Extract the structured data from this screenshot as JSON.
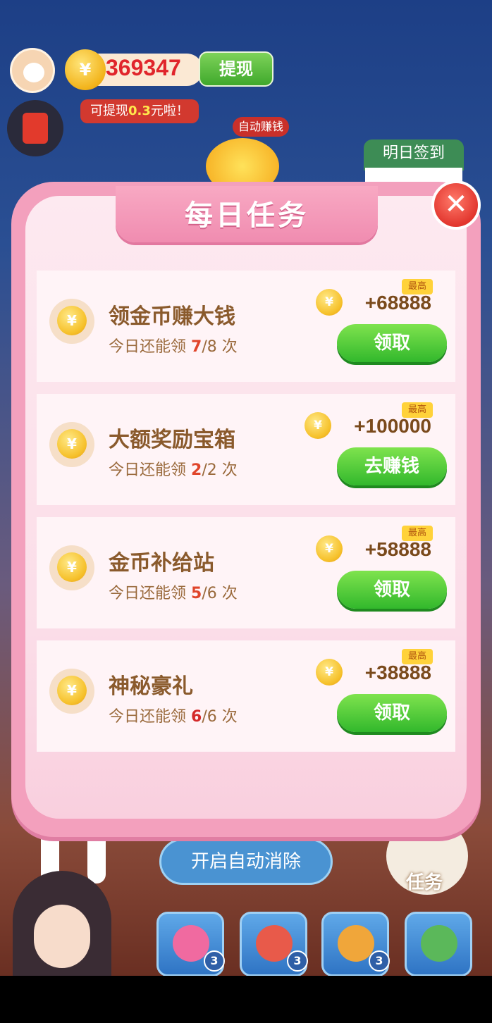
{
  "hud": {
    "coin_symbol": "¥",
    "coin_balance": "369347",
    "withdraw_label": "提现",
    "withdraw_tip_prefix": "可提现",
    "withdraw_tip_amount": "0.3",
    "withdraw_tip_suffix": "元啦！",
    "auto_earn_label": "自动赚钱",
    "sign_in_label": "明日签到"
  },
  "dialog": {
    "title": "每日任务",
    "close_glyph": "✕",
    "tasks": [
      {
        "name": "领金币赚大钱",
        "sub_prefix": "今日还能领 ",
        "count": "7",
        "total": "/8",
        "sub_suffix": " 次",
        "badge": "最高",
        "reward": "+68888",
        "action": "领取"
      },
      {
        "name": "大额奖励宝箱",
        "sub_prefix": "今日还能领 ",
        "count": "2",
        "total": "/2",
        "sub_suffix": " 次",
        "badge": "最高",
        "reward": "+100000",
        "action": "去赚钱"
      },
      {
        "name": "金币补给站",
        "sub_prefix": "今日还能领 ",
        "count": "5",
        "total": "/6",
        "sub_suffix": " 次",
        "badge": "最高",
        "reward": "+58888",
        "action": "领取"
      },
      {
        "name": "神秘豪礼",
        "sub_prefix": "今日还能领 ",
        "count": "6",
        "total": "/6",
        "sub_suffix": " 次",
        "badge": "最高",
        "reward": "+38888",
        "action": "领取"
      }
    ]
  },
  "bottom": {
    "auto_clear_label": "开启自动消除",
    "task_label": "任务",
    "props": [
      {
        "count": "3",
        "color": "#f06aa0"
      },
      {
        "count": "3",
        "color": "#e85a4a"
      },
      {
        "count": "3",
        "color": "#f0a63a"
      },
      {
        "count": "",
        "color": "#5bb85a"
      }
    ]
  },
  "colors": {
    "dialog_pink": "#f3a0bd",
    "button_green": "#32b82c",
    "coin_gold": "#f6c12b",
    "highlight_red": "#e0452b"
  }
}
